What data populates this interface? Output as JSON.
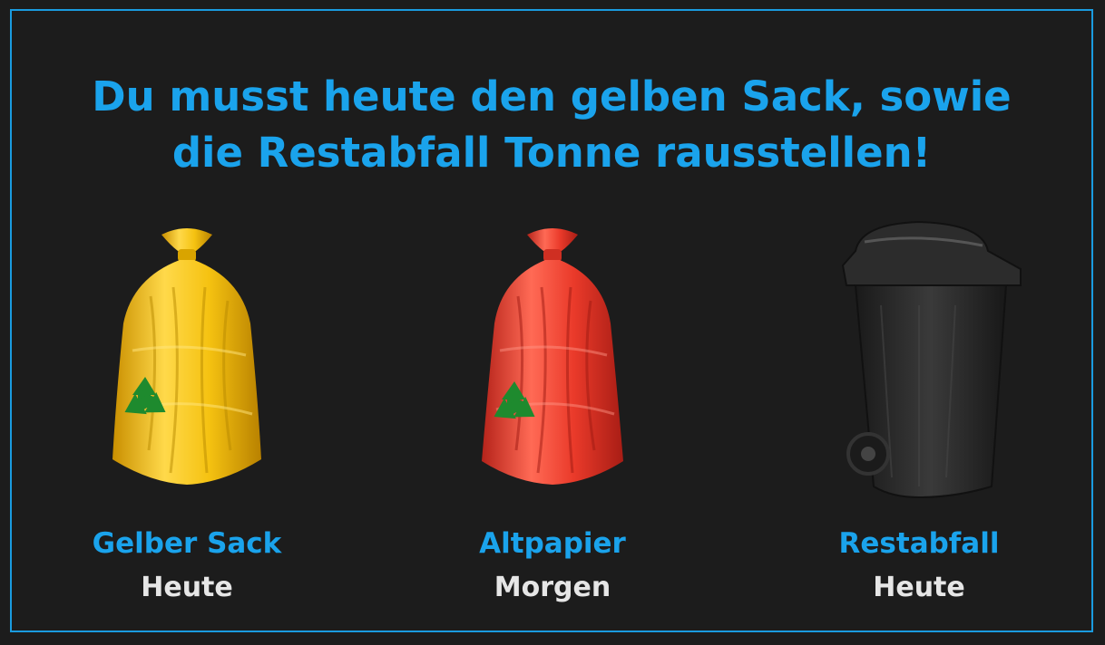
{
  "headline": {
    "line1": "Du musst heute den gelben Sack, sowie",
    "line2": "die Restabfall Tonne rausstellen!"
  },
  "colors": {
    "accent": "#1aa3ec",
    "border": "#1a9bdf",
    "background": "#1c1c1c",
    "status_text": "#e6e6e6",
    "yellow_bag": "#f2c10f",
    "red_bag": "#ea3a2a",
    "bin": "#2a2a2a"
  },
  "items": [
    {
      "name": "Gelber Sack",
      "when": "Heute",
      "icon": "yellow-bag-icon"
    },
    {
      "name": "Altpapier",
      "when": "Morgen",
      "icon": "red-bag-icon"
    },
    {
      "name": "Restabfall",
      "when": "Heute",
      "icon": "waste-bin-icon"
    }
  ]
}
